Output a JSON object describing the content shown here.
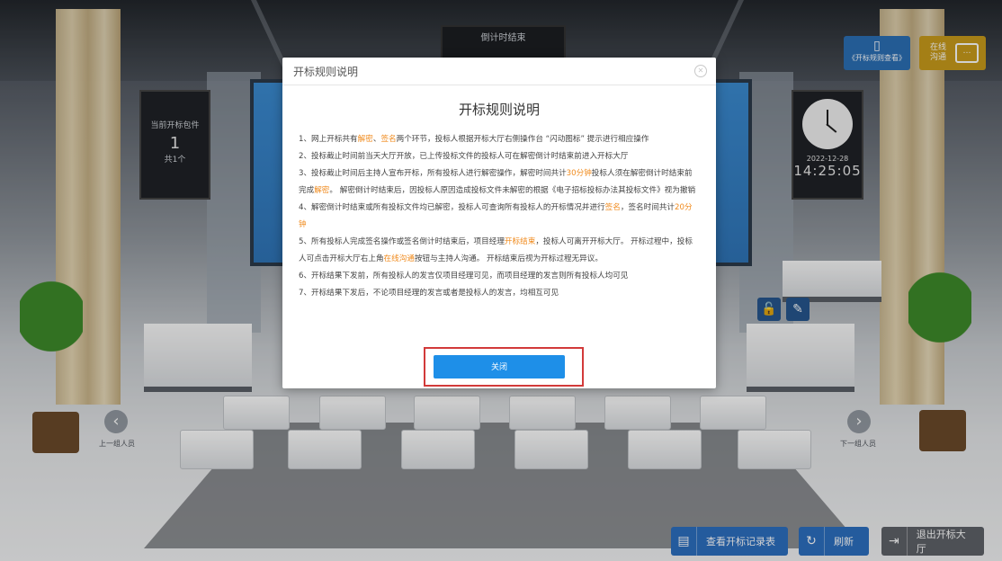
{
  "scene": {
    "countdown_screen": "倒计时结束",
    "current_package_label": "当前开标包件",
    "current_package_number": "1",
    "package_total": "共1个",
    "clock_date": "2022-12-28",
    "clock_time": "14:25:05",
    "prev_label": "上一组人员",
    "next_label": "下一组人员"
  },
  "top_buttons": {
    "rules_view": "《开标规则查看》",
    "online_chat": "在线沟通"
  },
  "bottom_buttons": {
    "view_records": "查看开标记录表",
    "refresh": "刷新",
    "exit_hall": "退出开标大厅"
  },
  "modal": {
    "header_title": "开标规则说明",
    "title": "开标规则说明",
    "close_button": "关闭",
    "rules": [
      [
        {
          "t": "1、网上开标共有"
        },
        {
          "t": "解密",
          "hl": true
        },
        {
          "t": "、"
        },
        {
          "t": "签名",
          "hl": true
        },
        {
          "t": "两个环节，投标人根据开标大厅右侧操作台 “闪动图标” 提示进行相应操作"
        }
      ],
      [
        {
          "t": "2、投标截止时间前当天大厅开放，已上传投标文件的投标人可在解密倒计时结束前进入开标大厅"
        }
      ],
      [
        {
          "t": "3、投标截止时间后主持人宣布开标，所有投标人进行解密操作，解密时间共计"
        },
        {
          "t": "30分钟",
          "hl": true
        },
        {
          "t": "投标人须在解密倒计时结束前完成"
        },
        {
          "t": "解密",
          "hl": true
        },
        {
          "t": "。 解密倒计时结束后，因投标人原因造成投标文件未解密的根据《电子招标投标办法其投标文件》视为撤销"
        }
      ],
      [
        {
          "t": "4、解密倒计时结束或所有投标文件均已解密，投标人可查询所有投标人的开标情况并进行"
        },
        {
          "t": "签名",
          "hl": true
        },
        {
          "t": "，签名时间共计"
        },
        {
          "t": "20分钟",
          "hl": true
        }
      ],
      [
        {
          "t": "5、所有投标人完成签名操作或签名倒计时结束后，项目经理"
        },
        {
          "t": "开标结束",
          "hl": true
        },
        {
          "t": "，投标人可离开开标大厅。 开标过程中，投标人可点击开标大厅右上角"
        },
        {
          "t": "在线沟通",
          "hl": true
        },
        {
          "t": "按钮与主持人沟通。 开标结束后视为开标过程无异议。"
        }
      ],
      [
        {
          "t": "6、开标结果下发前，所有投标人的发言仅项目经理可见，而项目经理的发言则所有投标人均可见"
        }
      ],
      [
        {
          "t": "7、开标结果下发后，不论项目经理的发言或者是投标人的发言，均相互可见"
        }
      ]
    ]
  },
  "colors": {
    "highlight": "#f08a1c",
    "primary_button": "#1e8fe8",
    "annotation_box": "#d23a3a",
    "bottom_button": "#2d6fc0"
  },
  "icons": {
    "close_modal": "close-circle-icon",
    "rules_view": "document-icon",
    "online_chat": "chat-icon",
    "view_records": "clipboard-icon",
    "refresh": "refresh-icon",
    "exit": "exit-door-icon",
    "lock": "lock-icon",
    "edit": "pencil-icon",
    "prev": "chevron-left-icon",
    "next": "chevron-right-icon"
  }
}
